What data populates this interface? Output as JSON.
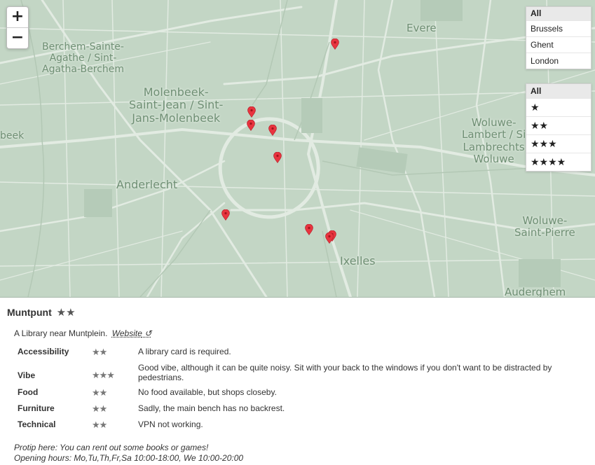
{
  "map": {
    "labels": [
      {
        "id": "berchem",
        "lines": [
          "Berchem-Sainte-",
          "Agathe / Sint-",
          "Agatha-Berchem"
        ]
      },
      {
        "id": "molenbeek",
        "lines": [
          "Molenbeek-",
          "Saint-Jean / Sint-",
          "Jans-Molenbeek"
        ]
      },
      {
        "id": "evere",
        "lines": [
          "Evere"
        ]
      },
      {
        "id": "beek",
        "lines": [
          "beek"
        ]
      },
      {
        "id": "anderlecht",
        "lines": [
          "Anderlecht"
        ]
      },
      {
        "id": "woluwe-lambert",
        "lines": [
          "Woluwe-",
          "Lambert / Si",
          "Lambrechts",
          "Woluwe"
        ]
      },
      {
        "id": "woluwe-pierre",
        "lines": [
          "Woluwe-",
          "Saint-Pierre"
        ]
      },
      {
        "id": "ixelles",
        "lines": [
          "Ixelles"
        ]
      },
      {
        "id": "auderghem",
        "lines": [
          "Auderghem"
        ]
      }
    ],
    "zoom": {
      "in": "+",
      "out": "−"
    },
    "pin_color": "#e8343f",
    "pin_count": 9
  },
  "city_filter": [
    "All",
    "Brussels",
    "Ghent",
    "London"
  ],
  "rating_filter": [
    "All",
    "★",
    "★★",
    "★★★",
    "★★★★"
  ],
  "panel": {
    "name": "Muntpunt",
    "stars": "★★",
    "description": "A Library near Muntplein.",
    "website_label": "Website",
    "website_icon": "↺",
    "criteria": [
      {
        "name": "Accessibility",
        "stars": "★★",
        "note": "A library card is required."
      },
      {
        "name": "Vibe",
        "stars": "★★★",
        "note": "Good vibe, although it can be quite noisy. Sit with your back to the windows if you don't want to be distracted by pedestrians."
      },
      {
        "name": "Food",
        "stars": "★★",
        "note": "No food available, but shops closeby."
      },
      {
        "name": "Furniture",
        "stars": "★★",
        "note": "Sadly, the main bench has no backrest."
      },
      {
        "name": "Technical",
        "stars": "★★",
        "note": "VPN not working."
      }
    ],
    "protip": "Protip here: You can rent out some books or games!",
    "hours": "Opening hours: Mo,Tu,Th,Fr,Sa 10:00-18:00, We 10:00-20:00"
  }
}
